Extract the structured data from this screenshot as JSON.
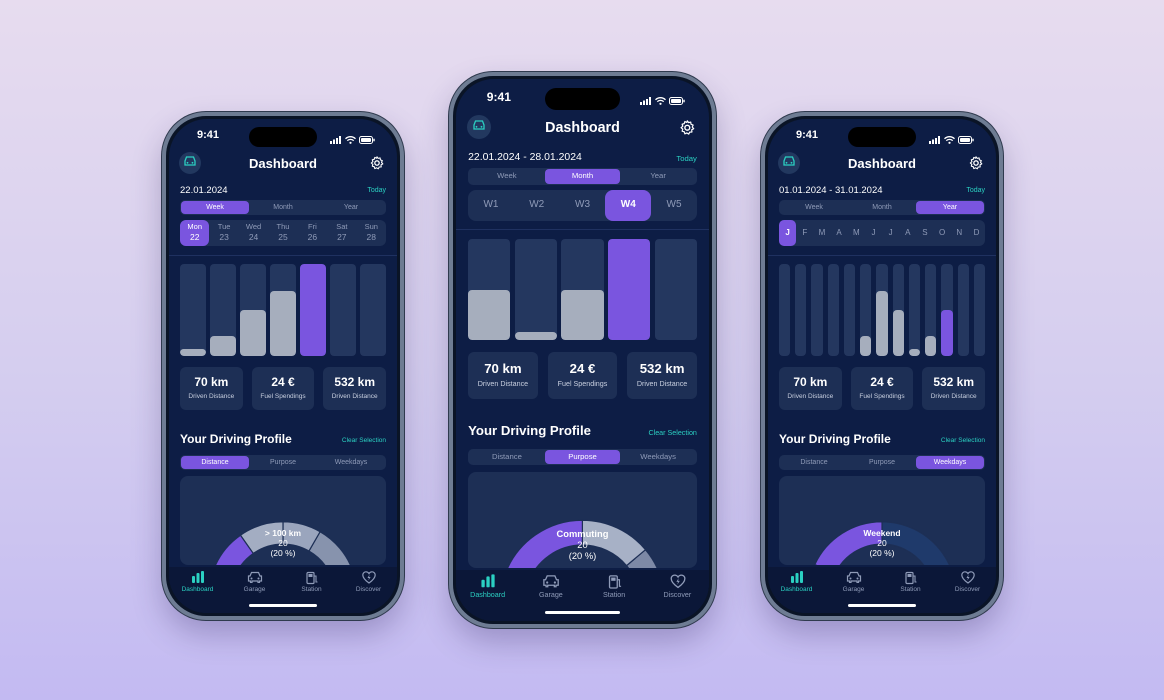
{
  "colors": {
    "accent": "#7a55df",
    "teal": "#2bd0c2",
    "screen_bg": "#0d1d45",
    "card_bg": "#1d2f55"
  },
  "phones": [
    {
      "time": "9:41",
      "title": "Dashboard",
      "date_range": "22.01.2024",
      "today_label": "Today",
      "period_tabs": [
        {
          "label": "Week",
          "selected": true
        },
        {
          "label": "Month",
          "selected": false
        },
        {
          "label": "Year",
          "selected": false
        }
      ],
      "days": [
        {
          "name": "Mon",
          "num": "22",
          "selected": true
        },
        {
          "name": "Tue",
          "num": "23",
          "selected": false
        },
        {
          "name": "Wed",
          "num": "24",
          "selected": false
        },
        {
          "name": "Thu",
          "num": "25",
          "selected": false
        },
        {
          "name": "Fri",
          "num": "26",
          "selected": false
        },
        {
          "name": "Sat",
          "num": "27",
          "selected": false
        },
        {
          "name": "Sun",
          "num": "28",
          "selected": false
        }
      ],
      "bar_levels": [
        0.08,
        0.22,
        0.5,
        0.71,
        1.0,
        0,
        0
      ],
      "bar_selected": 4,
      "stats": [
        {
          "value": "70 km",
          "label": "Driven Distance"
        },
        {
          "value": "24 €",
          "label": "Fuel Spendings"
        },
        {
          "value": "532 km",
          "label": "Driven Distance"
        }
      ],
      "profile_title": "Your Driving Profile",
      "clear_label": "Clear Selection",
      "profile_tabs": [
        {
          "label": "Distance",
          "selected": true
        },
        {
          "label": "Purpose",
          "selected": false
        },
        {
          "label": "Weekdays",
          "selected": false
        }
      ],
      "donut": {
        "line1": "> 100 km",
        "line2": "20",
        "line3": "(20 %)"
      },
      "nav": [
        {
          "label": "Dashboard",
          "icon": "bar-chart-icon",
          "selected": true
        },
        {
          "label": "Garage",
          "icon": "car-icon",
          "selected": false
        },
        {
          "label": "Station",
          "icon": "fuel-pump-icon",
          "selected": false
        },
        {
          "label": "Discover",
          "icon": "heart-bolt-icon",
          "selected": false
        }
      ]
    },
    {
      "time": "9:41",
      "title": "Dashboard",
      "date_range": "22.01.2024 - 28.01.2024",
      "today_label": "Today",
      "period_tabs": [
        {
          "label": "Week",
          "selected": false
        },
        {
          "label": "Month",
          "selected": true
        },
        {
          "label": "Year",
          "selected": false
        }
      ],
      "weeks": [
        {
          "label": "W1",
          "selected": false
        },
        {
          "label": "W2",
          "selected": false
        },
        {
          "label": "W3",
          "selected": false
        },
        {
          "label": "W4",
          "selected": true
        },
        {
          "label": "W5",
          "selected": false
        }
      ],
      "bar_levels": [
        0.49,
        0.08,
        0.49,
        1.0,
        0
      ],
      "bar_selected": 3,
      "stats": [
        {
          "value": "70 km",
          "label": "Driven Distance"
        },
        {
          "value": "24 €",
          "label": "Fuel Spendings"
        },
        {
          "value": "532 km",
          "label": "Driven Distance"
        }
      ],
      "profile_title": "Your Driving Profile",
      "clear_label": "Clear Selection",
      "profile_tabs": [
        {
          "label": "Distance",
          "selected": false
        },
        {
          "label": "Purpose",
          "selected": true
        },
        {
          "label": "Weekdays",
          "selected": false
        }
      ],
      "donut": {
        "line1": "Commuting",
        "line2": "20",
        "line3": "(20 %)"
      },
      "nav": [
        {
          "label": "Dashboard",
          "icon": "bar-chart-icon",
          "selected": true
        },
        {
          "label": "Garage",
          "icon": "car-icon",
          "selected": false
        },
        {
          "label": "Station",
          "icon": "fuel-pump-icon",
          "selected": false
        },
        {
          "label": "Discover",
          "icon": "heart-bolt-icon",
          "selected": false
        }
      ]
    },
    {
      "time": "9:41",
      "title": "Dashboard",
      "date_range": "01.01.2024 - 31.01.2024",
      "today_label": "Today",
      "period_tabs": [
        {
          "label": "Week",
          "selected": false
        },
        {
          "label": "Month",
          "selected": false
        },
        {
          "label": "Year",
          "selected": true
        }
      ],
      "months": [
        {
          "label": "J",
          "selected": true
        },
        {
          "label": "F",
          "selected": false
        },
        {
          "label": "M",
          "selected": false
        },
        {
          "label": "A",
          "selected": false
        },
        {
          "label": "M",
          "selected": false
        },
        {
          "label": "J",
          "selected": false
        },
        {
          "label": "J",
          "selected": false
        },
        {
          "label": "A",
          "selected": false
        },
        {
          "label": "S",
          "selected": false
        },
        {
          "label": "O",
          "selected": false
        },
        {
          "label": "N",
          "selected": false
        },
        {
          "label": "D",
          "selected": false
        }
      ],
      "bar_levels": [
        0,
        0,
        0,
        0,
        0,
        0.22,
        0.71,
        0.5,
        0.08,
        0.22,
        0.5,
        0,
        0
      ],
      "bar_selected": 10,
      "stats": [
        {
          "value": "70 km",
          "label": "Driven Distance"
        },
        {
          "value": "24 €",
          "label": "Fuel Spendings"
        },
        {
          "value": "532 km",
          "label": "Driven Distance"
        }
      ],
      "profile_title": "Your Driving Profile",
      "clear_label": "Clear Selection",
      "profile_tabs": [
        {
          "label": "Distance",
          "selected": false
        },
        {
          "label": "Purpose",
          "selected": false
        },
        {
          "label": "Weekdays",
          "selected": true
        }
      ],
      "donut": {
        "line1": "Weekend",
        "line2": "20",
        "line3": "(20 %)"
      },
      "nav": [
        {
          "label": "Dashboard",
          "icon": "bar-chart-icon",
          "selected": true
        },
        {
          "label": "Garage",
          "icon": "car-icon",
          "selected": false
        },
        {
          "label": "Station",
          "icon": "fuel-pump-icon",
          "selected": false
        },
        {
          "label": "Discover",
          "icon": "heart-bolt-icon",
          "selected": false
        }
      ]
    }
  ]
}
